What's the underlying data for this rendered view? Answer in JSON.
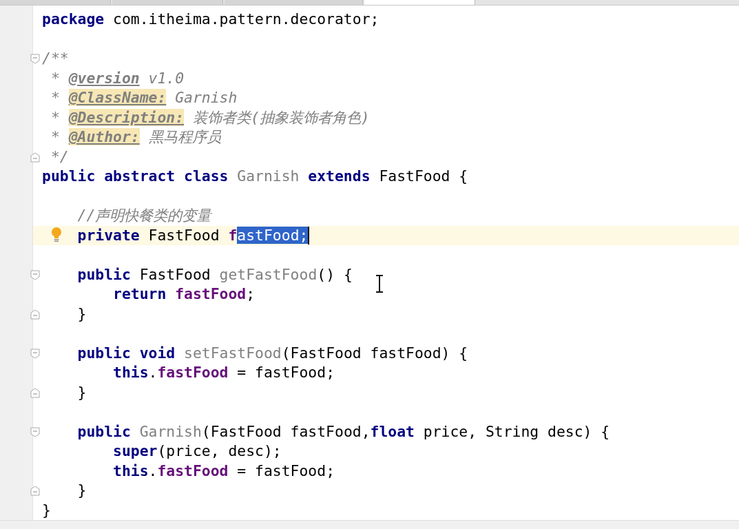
{
  "tabs": [
    {
      "selected": false
    },
    {
      "selected": false
    },
    {
      "selected": false
    },
    {
      "selected": true
    }
  ],
  "lines": [
    {
      "kind": "code",
      "tokens": [
        {
          "text": "package",
          "kind": "kw"
        },
        {
          "text": " com.itheima.pattern.decorator;",
          "kind": "plain"
        }
      ]
    },
    {
      "kind": "blank"
    },
    {
      "kind": "code",
      "fold_start": true,
      "tokens": [
        {
          "text": "/**",
          "kind": "doc"
        }
      ]
    },
    {
      "kind": "code",
      "tokens": [
        {
          "text": " * ",
          "kind": "doc"
        },
        {
          "text": "@version",
          "kind": "doctag"
        },
        {
          "text": " v1.0",
          "kind": "doc"
        }
      ]
    },
    {
      "kind": "code",
      "tokens": [
        {
          "text": " * ",
          "kind": "doc"
        },
        {
          "text": "@ClassName:",
          "kind": "doctag-marked"
        },
        {
          "text": " Garnish",
          "kind": "doc"
        }
      ]
    },
    {
      "kind": "code",
      "tokens": [
        {
          "text": " * ",
          "kind": "doc"
        },
        {
          "text": "@Description:",
          "kind": "doctag-marked"
        },
        {
          "text": " 装饰者类(抽象装饰者角色)",
          "kind": "doc"
        }
      ]
    },
    {
      "kind": "code",
      "tokens": [
        {
          "text": " * ",
          "kind": "doc"
        },
        {
          "text": "@Author:",
          "kind": "doctag-marked"
        },
        {
          "text": " 黑马程序员",
          "kind": "doc"
        }
      ]
    },
    {
      "kind": "code",
      "fold_end": true,
      "tokens": [
        {
          "text": " */",
          "kind": "doc"
        }
      ]
    },
    {
      "kind": "code",
      "tokens": [
        {
          "text": "public abstract class ",
          "kind": "kw"
        },
        {
          "text": "Garnish ",
          "kind": "unused"
        },
        {
          "text": "extends",
          "kind": "kw"
        },
        {
          "text": " FastFood {",
          "kind": "plain"
        }
      ]
    },
    {
      "kind": "blank"
    },
    {
      "kind": "code",
      "tokens": [
        {
          "text": "    //声明快餐类的变量",
          "kind": "comment"
        }
      ]
    },
    {
      "kind": "code",
      "current": true,
      "bulb": true,
      "caret": true,
      "tokens": [
        {
          "text": "    private",
          "kind": "kw"
        },
        {
          "text": " FastFood ",
          "kind": "plain"
        },
        {
          "text": "f",
          "kind": "field"
        },
        {
          "text": "astFood;",
          "kind": "selection"
        }
      ]
    },
    {
      "kind": "blank"
    },
    {
      "kind": "code",
      "fold_start": true,
      "tokens": [
        {
          "text": "    public",
          "kind": "kw"
        },
        {
          "text": " FastFood ",
          "kind": "plain"
        },
        {
          "text": "getFastFood",
          "kind": "unused"
        },
        {
          "text": "() {",
          "kind": "plain"
        }
      ]
    },
    {
      "kind": "code",
      "tokens": [
        {
          "text": "        return ",
          "kind": "kw"
        },
        {
          "text": "fastFood",
          "kind": "field"
        },
        {
          "text": ";",
          "kind": "plain"
        }
      ]
    },
    {
      "kind": "code",
      "fold_end": true,
      "tokens": [
        {
          "text": "    }",
          "kind": "plain"
        }
      ]
    },
    {
      "kind": "blank"
    },
    {
      "kind": "code",
      "fold_start": true,
      "tokens": [
        {
          "text": "    public void ",
          "kind": "kw"
        },
        {
          "text": "setFastFood",
          "kind": "unused"
        },
        {
          "text": "(FastFood fastFood) {",
          "kind": "plain"
        }
      ]
    },
    {
      "kind": "code",
      "tokens": [
        {
          "text": "        this",
          "kind": "kw"
        },
        {
          "text": ".",
          "kind": "plain"
        },
        {
          "text": "fastFood",
          "kind": "field"
        },
        {
          "text": " = fastFood;",
          "kind": "plain"
        }
      ]
    },
    {
      "kind": "code",
      "fold_end": true,
      "tokens": [
        {
          "text": "    }",
          "kind": "plain"
        }
      ]
    },
    {
      "kind": "blank"
    },
    {
      "kind": "code",
      "fold_start": true,
      "tokens": [
        {
          "text": "    public ",
          "kind": "kw"
        },
        {
          "text": "Garnish",
          "kind": "unused"
        },
        {
          "text": "(FastFood fastFood,",
          "kind": "plain"
        },
        {
          "text": "float",
          "kind": "kw"
        },
        {
          "text": " price, String desc) {",
          "kind": "plain"
        }
      ]
    },
    {
      "kind": "code",
      "tokens": [
        {
          "text": "        super",
          "kind": "kw"
        },
        {
          "text": "(price, desc);",
          "kind": "plain"
        }
      ]
    },
    {
      "kind": "code",
      "tokens": [
        {
          "text": "        this",
          "kind": "kw"
        },
        {
          "text": ".",
          "kind": "plain"
        },
        {
          "text": "fastFood",
          "kind": "field"
        },
        {
          "text": " = fastFood;",
          "kind": "plain"
        }
      ]
    },
    {
      "kind": "code",
      "fold_end": true,
      "tokens": [
        {
          "text": "    }",
          "kind": "plain"
        }
      ]
    },
    {
      "kind": "code",
      "tokens": [
        {
          "text": "}",
          "kind": "plain"
        }
      ]
    }
  ]
}
